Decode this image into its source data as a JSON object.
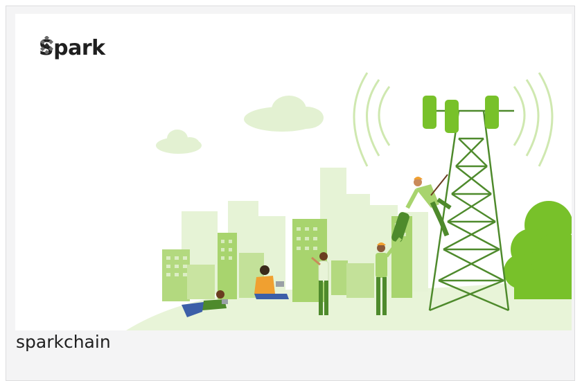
{
  "card": {
    "title": "sparkchain",
    "logo": {
      "text": "Spark",
      "icon": "spark-diamond-dots-icon"
    },
    "illustration": "cell-tower-city-illustration"
  },
  "colors": {
    "green_dark": "#4e8a2c",
    "green_mid": "#78c12a",
    "green_light": "#d8ecbd",
    "green_pale": "#e8f4d8",
    "card_bg": "#f4f4f5"
  }
}
